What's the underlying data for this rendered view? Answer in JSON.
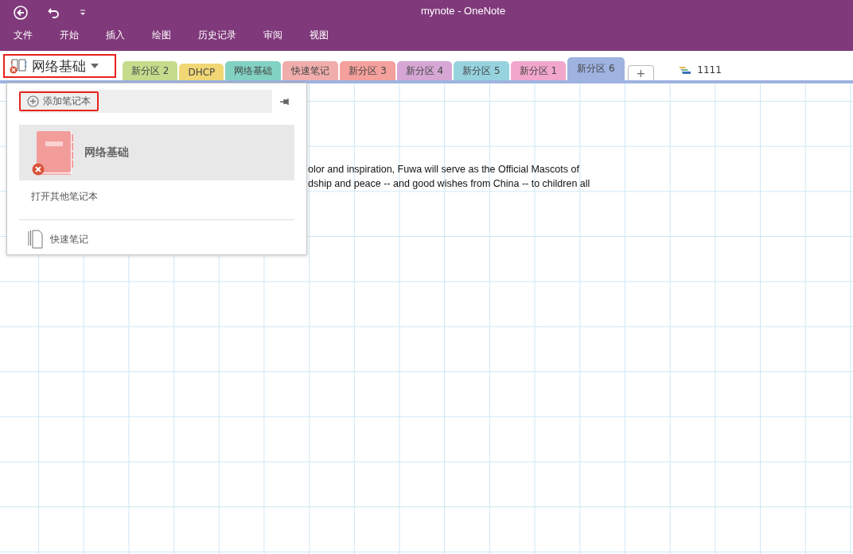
{
  "window": {
    "title": "mynote - OneNote"
  },
  "ribbon_tabs": [
    "文件",
    "开始",
    "插入",
    "绘图",
    "历史记录",
    "审阅",
    "视图"
  ],
  "notebook": {
    "name": "网络基础"
  },
  "section_tabs": [
    {
      "label": "新分区 2",
      "color": "#c5dc8c",
      "selected": false
    },
    {
      "label": "DHCP",
      "color": "#f1d675",
      "selected": false
    },
    {
      "label": "网络基础",
      "color": "#82d2c3",
      "selected": false
    },
    {
      "label": "快速笔记",
      "color": "#f0adab",
      "selected": false
    },
    {
      "label": "新分区 3",
      "color": "#f4a09c",
      "selected": false
    },
    {
      "label": "新分区 4",
      "color": "#d6a7d4",
      "selected": false
    },
    {
      "label": "新分区 5",
      "color": "#96d3df",
      "selected": false
    },
    {
      "label": "新分区 1",
      "color": "#f2a6cc",
      "selected": false
    },
    {
      "label": "新分区 6",
      "color": "#9eb3e0",
      "selected": true
    }
  ],
  "add_section": "+",
  "section_group": "1111",
  "note_lines": [
    "olor and inspiration, Fuwa will serve as the Official Mascots of",
    "dship and peace -- and good wishes from China -- to children all"
  ],
  "notebook_menu": {
    "add_notebook": "添加笔记本",
    "notebooks": [
      {
        "name": "网络基础",
        "selected": true
      }
    ],
    "open_other": "打开其他笔记本",
    "quick_notes": "快速笔记"
  }
}
